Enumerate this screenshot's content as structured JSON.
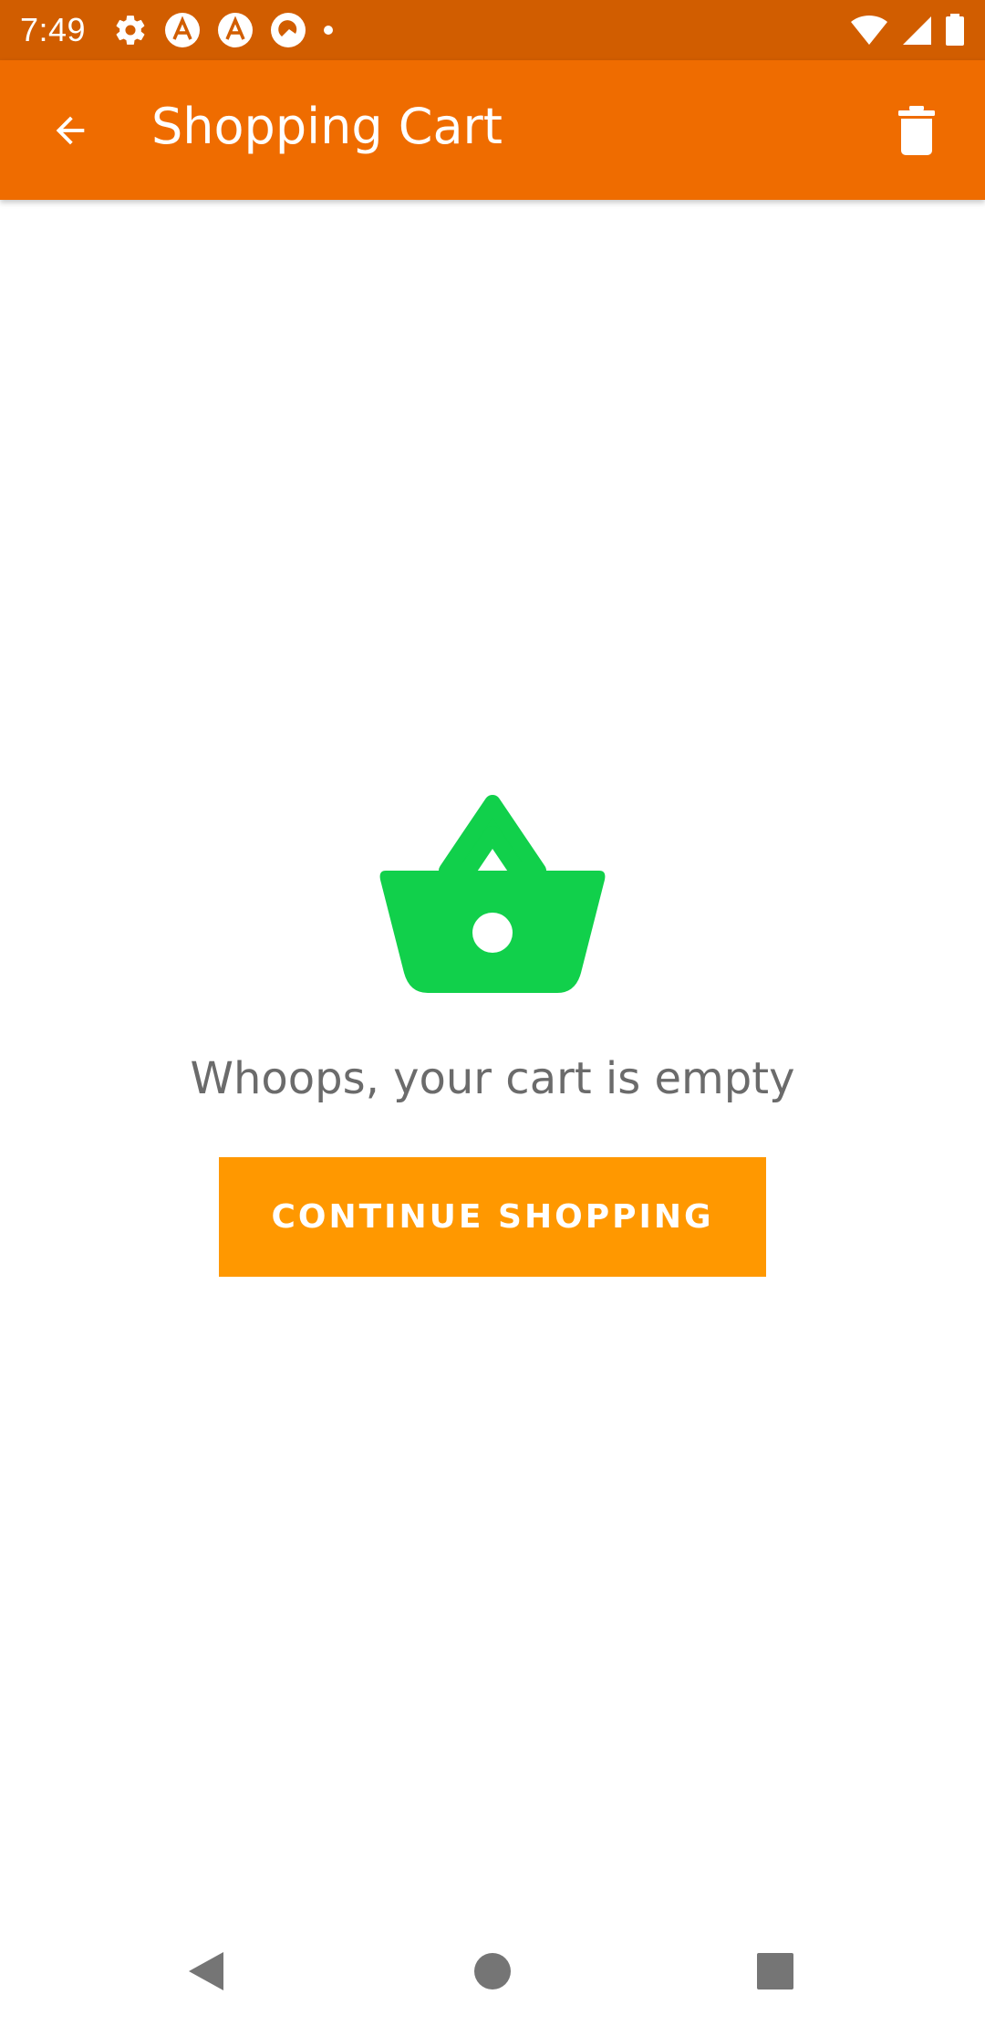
{
  "status_bar": {
    "time": "7:49",
    "left_icons": [
      "settings-icon",
      "app-a-icon",
      "app-a-icon",
      "app-circle-icon",
      "dot-icon"
    ],
    "right_icons": [
      "wifi-icon",
      "signal-icon",
      "battery-icon"
    ]
  },
  "app_bar": {
    "title": "Shopping Cart",
    "back_icon": "arrow-back-icon",
    "action_icon": "trash-icon",
    "color": "#ef6c00"
  },
  "empty_state": {
    "icon": "basket-icon",
    "icon_color": "#11d04b",
    "message": "Whoops, your cart is empty",
    "button_label": "CONTINUE SHOPPING",
    "button_color": "#ff9800"
  },
  "nav_bar": {
    "buttons": [
      "back-triangle-icon",
      "home-circle-icon",
      "recents-square-icon"
    ]
  }
}
